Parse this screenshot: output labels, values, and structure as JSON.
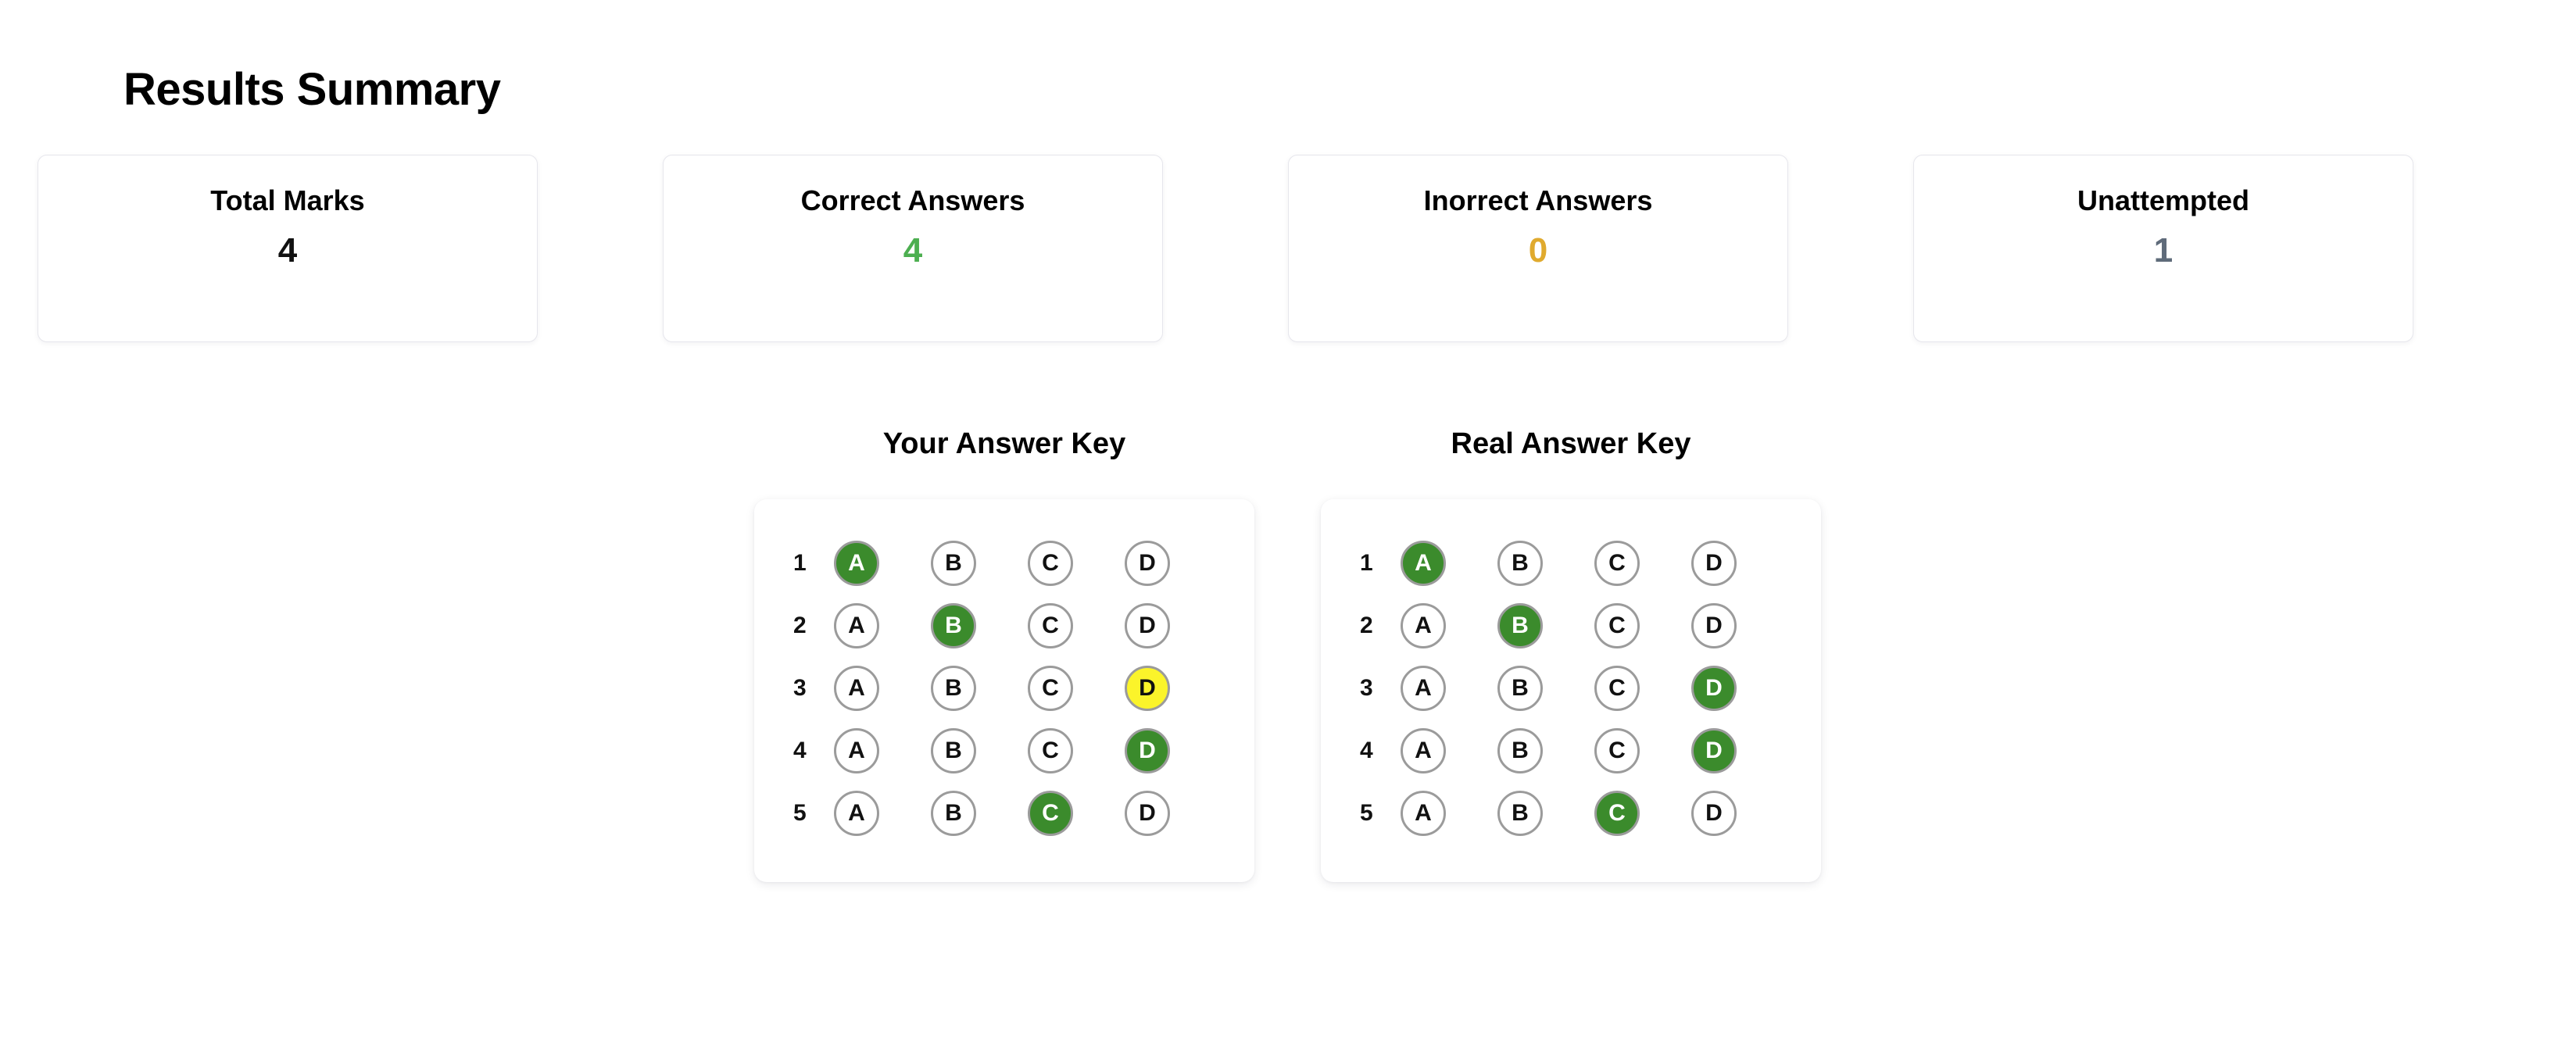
{
  "page": {
    "title": "Results Summary",
    "background": "#ffffff"
  },
  "colors": {
    "correct_green": "#3b8b2c",
    "value_green": "#4caf50",
    "value_amber": "#e0aa2e",
    "value_slate": "#5f6b7a",
    "unattempted_yellow": "#fbf42a",
    "bubble_border": "#9b9b9b",
    "card_border": "#e6e6ec"
  },
  "stats": [
    {
      "label": "Total Marks",
      "value": "4",
      "tone": "tone-dark"
    },
    {
      "label": "Correct Answers",
      "value": "4",
      "tone": "tone-green"
    },
    {
      "label": "Inorrect Answers",
      "value": "0",
      "tone": "tone-amber"
    },
    {
      "label": "Unattempted",
      "value": "1",
      "tone": "tone-slate"
    }
  ],
  "answer_keys": [
    {
      "heading": "Your Answer Key",
      "rows": [
        {
          "number": "1",
          "options": [
            {
              "letter": "A",
              "state": "correct"
            },
            {
              "letter": "B",
              "state": "empty"
            },
            {
              "letter": "C",
              "state": "empty"
            },
            {
              "letter": "D",
              "state": "empty"
            }
          ]
        },
        {
          "number": "2",
          "options": [
            {
              "letter": "A",
              "state": "empty"
            },
            {
              "letter": "B",
              "state": "correct"
            },
            {
              "letter": "C",
              "state": "empty"
            },
            {
              "letter": "D",
              "state": "empty"
            }
          ]
        },
        {
          "number": "3",
          "options": [
            {
              "letter": "A",
              "state": "empty"
            },
            {
              "letter": "B",
              "state": "empty"
            },
            {
              "letter": "C",
              "state": "empty"
            },
            {
              "letter": "D",
              "state": "unattempted-pick"
            }
          ]
        },
        {
          "number": "4",
          "options": [
            {
              "letter": "A",
              "state": "empty"
            },
            {
              "letter": "B",
              "state": "empty"
            },
            {
              "letter": "C",
              "state": "empty"
            },
            {
              "letter": "D",
              "state": "correct"
            }
          ]
        },
        {
          "number": "5",
          "options": [
            {
              "letter": "A",
              "state": "empty"
            },
            {
              "letter": "B",
              "state": "empty"
            },
            {
              "letter": "C",
              "state": "correct"
            },
            {
              "letter": "D",
              "state": "empty"
            }
          ]
        }
      ]
    },
    {
      "heading": "Real Answer Key",
      "rows": [
        {
          "number": "1",
          "options": [
            {
              "letter": "A",
              "state": "correct"
            },
            {
              "letter": "B",
              "state": "empty"
            },
            {
              "letter": "C",
              "state": "empty"
            },
            {
              "letter": "D",
              "state": "empty"
            }
          ]
        },
        {
          "number": "2",
          "options": [
            {
              "letter": "A",
              "state": "empty"
            },
            {
              "letter": "B",
              "state": "correct"
            },
            {
              "letter": "C",
              "state": "empty"
            },
            {
              "letter": "D",
              "state": "empty"
            }
          ]
        },
        {
          "number": "3",
          "options": [
            {
              "letter": "A",
              "state": "empty"
            },
            {
              "letter": "B",
              "state": "empty"
            },
            {
              "letter": "C",
              "state": "empty"
            },
            {
              "letter": "D",
              "state": "correct"
            }
          ]
        },
        {
          "number": "4",
          "options": [
            {
              "letter": "A",
              "state": "empty"
            },
            {
              "letter": "B",
              "state": "empty"
            },
            {
              "letter": "C",
              "state": "empty"
            },
            {
              "letter": "D",
              "state": "correct"
            }
          ]
        },
        {
          "number": "5",
          "options": [
            {
              "letter": "A",
              "state": "empty"
            },
            {
              "letter": "B",
              "state": "empty"
            },
            {
              "letter": "C",
              "state": "correct"
            },
            {
              "letter": "D",
              "state": "empty"
            }
          ]
        }
      ]
    }
  ]
}
